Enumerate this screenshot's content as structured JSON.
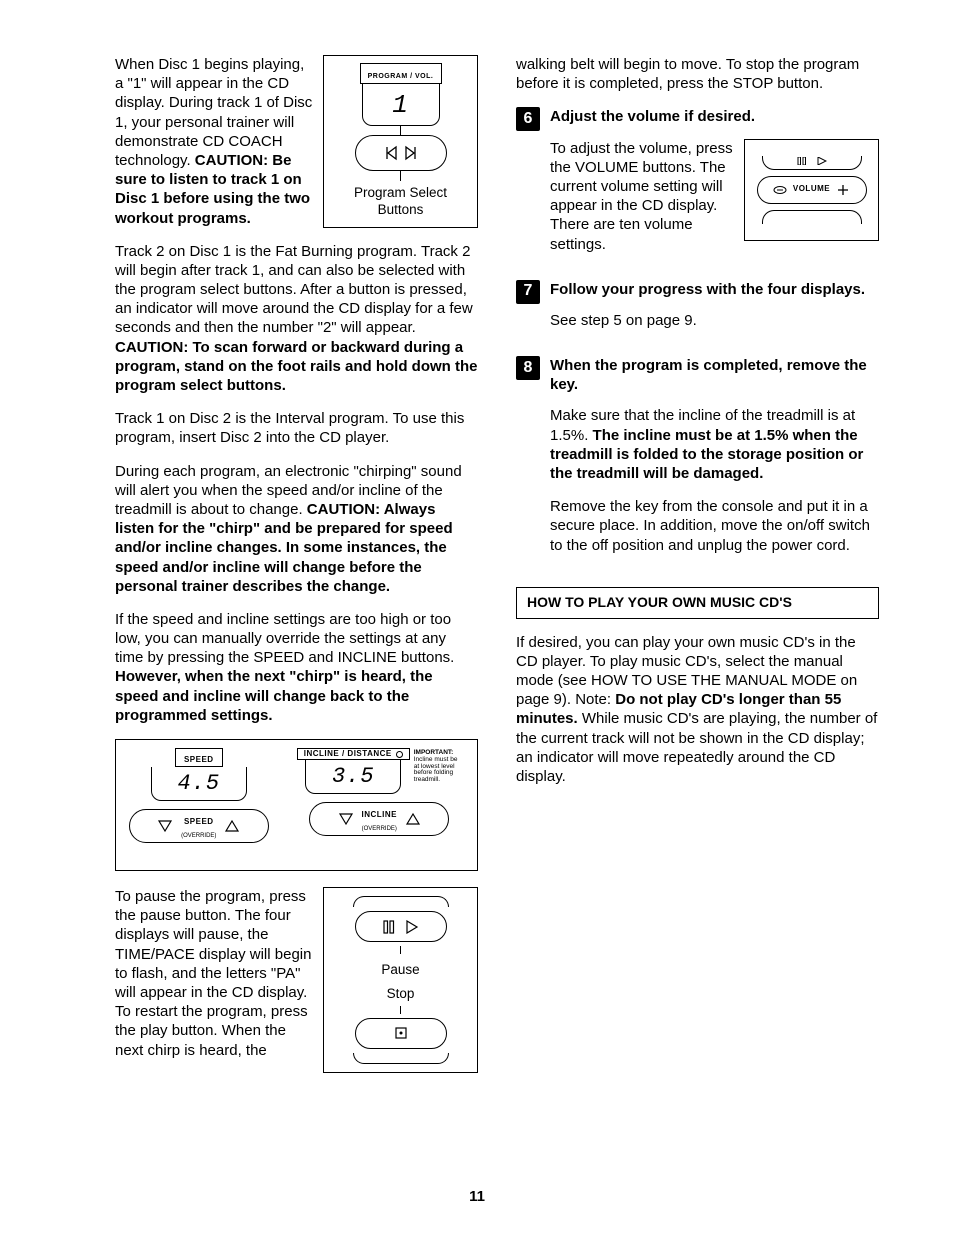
{
  "pageNumber": "11",
  "left": {
    "p1a": "When Disc 1 begins playing, a \"1\" will appear in the CD display. During track 1 of Disc 1, your personal trainer will demonstrate CD COACH technology. ",
    "p1b": "CAUTION: Be sure to listen to track 1 on Disc 1 before using the two workout programs.",
    "fig1_top": "PROGRAM / VOL.",
    "fig1_digit": "1",
    "fig1_label1": "Program Select",
    "fig1_label2": "Buttons",
    "p2a": "Track 2 on Disc 1 is the Fat Burning program. Track 2 will begin after track 1, and can also be selected with the program select buttons. After a button is pressed, an indicator will move around the CD display for a few seconds and then the number \"2\" will appear. ",
    "p2b": "CAUTION: To scan forward or backward during a program, stand on the foot rails and hold down the program select buttons.",
    "p3": "Track 1 on Disc 2 is the Interval program. To use this program, insert Disc 2 into the CD player.",
    "p4a": "During each program, an electronic \"chirping\" sound will alert you when the speed and/or incline of the treadmill is about to change. ",
    "p4b": "CAUTION: Always listen for the \"chirp\" and be prepared for speed and/or incline changes. In some instances, the speed and/or incline will change before the personal trainer describes the change.",
    "p5a": "If the speed and incline settings are too high or too low, you can manually override the settings at any time by pressing the SPEED and INCLINE buttons. ",
    "p5b": "However, when the next \"chirp\" is heard, the speed and incline will change back to the programmed settings.",
    "fig2_speed_label": "SPEED",
    "fig2_speed_val": "4.5",
    "fig2_speed_btn": "SPEED",
    "fig2_override": "(OVERRIDE)",
    "fig2_incline_label": "INCLINE / DISTANCE",
    "fig2_incline_val": "3.5",
    "fig2_incline_btn": "INCLINE",
    "fig2_important_h": "IMPORTANT:",
    "fig2_important_t": "Incline must be at lowest level before folding treadmill.",
    "p6": "To pause the program, press the pause button. The four displays will pause, the TIME/PACE display will begin to flash, and the letters \"PA\" will appear in the CD display. To restart the program, press the play button. When the next chirp is heard, the",
    "fig3_pause": "Pause",
    "fig3_stop": "Stop"
  },
  "right": {
    "p1": "walking belt will begin to move. To stop the program before it is completed, press the STOP button.",
    "step6": {
      "num": "6",
      "head": "Adjust the volume if desired.",
      "body": "To adjust the volume, press the VOLUME buttons. The current volume setting will appear in the CD display. There are ten volume settings.",
      "fig_label": "VOLUME"
    },
    "step7": {
      "num": "7",
      "head": "Follow your progress with the four displays.",
      "body": "See step 5 on page 9."
    },
    "step8": {
      "num": "8",
      "head": "When the program is completed, remove the key.",
      "body1a": "Make sure that the incline of the treadmill is at 1.5%. ",
      "body1b": "The incline must be at 1.5% when the treadmill is folded to the storage position or the treadmill will be damaged.",
      "body2": "Remove the key from the console and put it in a secure place. In addition, move the on/off switch to the off position and unplug the power cord."
    },
    "sectionHead": "HOW TO PLAY YOUR OWN MUSIC CD'S",
    "p2a": "If desired, you can play your own music CD's in the CD player. To play music CD's, select the manual mode (see HOW TO USE THE MANUAL MODE on page 9). Note: ",
    "p2b": "Do not play CD's longer than 55 minutes.",
    "p2c": " While music CD's are playing, the number of the current track will not be shown in the CD display; an indicator will move repeatedly around the CD display."
  }
}
